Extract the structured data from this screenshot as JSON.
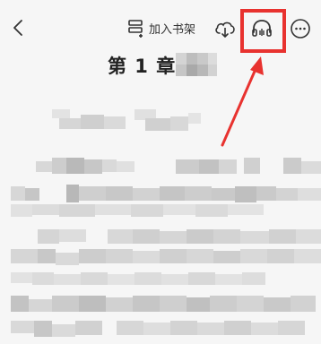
{
  "header": {
    "add_to_shelf_label": "加入书架",
    "back_icon": "chevron-left-icon",
    "shelf_icon": "bookshelf-icon",
    "download_icon": "cloud-download-icon",
    "listen_icon": "headphones-icon",
    "more_icon": "more-icon"
  },
  "content": {
    "chapter_title": "第 1 章"
  },
  "colors": {
    "highlight": "#e8322f",
    "background": "#f6f6f6"
  }
}
